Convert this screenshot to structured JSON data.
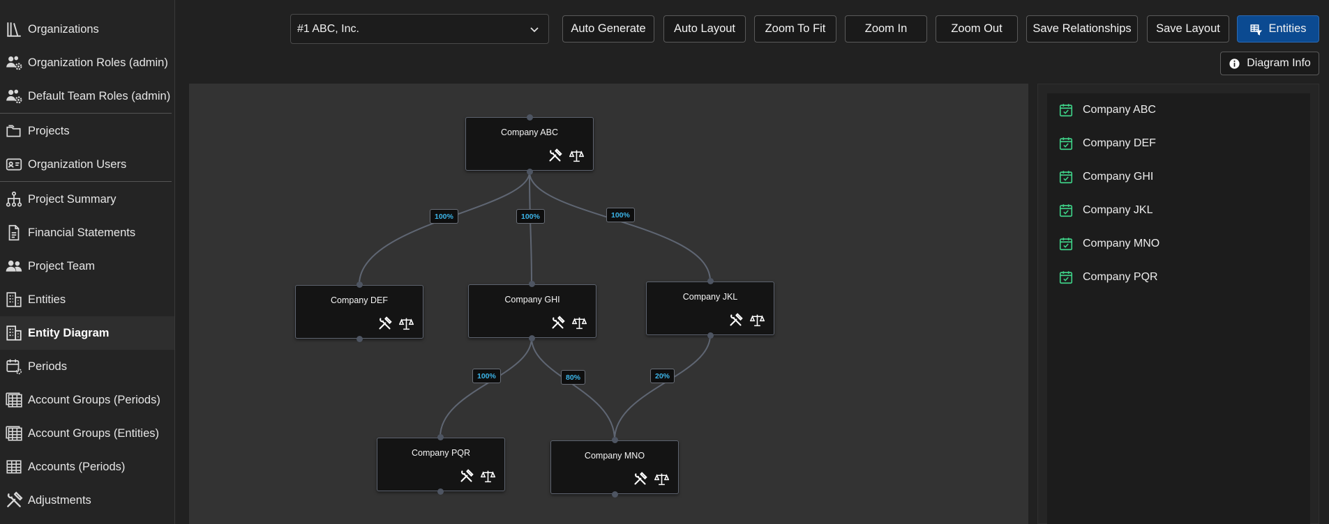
{
  "sidebar": {
    "items": [
      {
        "label": "Organizations",
        "icon": "books-icon"
      },
      {
        "label": "Organization Roles (admin)",
        "icon": "users-gear-icon"
      },
      {
        "label": "Default Team Roles (admin)",
        "icon": "users-gear-icon"
      },
      {
        "label": "Projects",
        "icon": "folders-icon"
      },
      {
        "label": "Organization Users",
        "icon": "id-card-icon"
      },
      {
        "label": "Project Summary",
        "icon": "hierarchy-icon"
      },
      {
        "label": "Financial Statements",
        "icon": "document-icon"
      },
      {
        "label": "Project Team",
        "icon": "users-icon"
      },
      {
        "label": "Entities",
        "icon": "buildings-icon"
      },
      {
        "label": "Entity Diagram",
        "icon": "buildings-icon",
        "active": true
      },
      {
        "label": "Periods",
        "icon": "calendar-gear-icon"
      },
      {
        "label": "Account Groups (Periods)",
        "icon": "table-stack-icon"
      },
      {
        "label": "Account Groups (Entities)",
        "icon": "table-stack-icon"
      },
      {
        "label": "Accounts (Periods)",
        "icon": "table-icon"
      },
      {
        "label": "Adjustments",
        "icon": "tools-icon"
      }
    ]
  },
  "toolbar": {
    "organization_select": "#1 ABC, Inc.",
    "auto_generate": "Auto Generate",
    "auto_layout": "Auto Layout",
    "zoom_to_fit": "Zoom To Fit",
    "zoom_in": "Zoom In",
    "zoom_out": "Zoom Out",
    "save_relationships": "Save Relationships",
    "save_layout": "Save Layout",
    "entities": "Entities",
    "diagram_info": "Diagram Info"
  },
  "diagram": {
    "nodes": [
      {
        "id": "abc",
        "label": "Company ABC"
      },
      {
        "id": "def",
        "label": "Company DEF"
      },
      {
        "id": "ghi",
        "label": "Company GHI"
      },
      {
        "id": "jkl",
        "label": "Company JKL"
      },
      {
        "id": "pqr",
        "label": "Company PQR"
      },
      {
        "id": "mno",
        "label": "Company MNO"
      }
    ],
    "edges": [
      {
        "from": "abc",
        "to": "def",
        "label": "100%"
      },
      {
        "from": "abc",
        "to": "ghi",
        "label": "100%"
      },
      {
        "from": "abc",
        "to": "jkl",
        "label": "100%"
      },
      {
        "from": "ghi",
        "to": "pqr",
        "label": "100%"
      },
      {
        "from": "ghi",
        "to": "mno",
        "label": "80%"
      },
      {
        "from": "jkl",
        "to": "mno",
        "label": "20%"
      }
    ]
  },
  "entities_panel": {
    "items": [
      "Company ABC",
      "Company DEF",
      "Company GHI",
      "Company JKL",
      "Company MNO",
      "Company PQR"
    ]
  },
  "colors": {
    "accent_primary": "#0b4a91",
    "badge_text": "#3cb6ea",
    "check_green": "#3ecf86"
  }
}
